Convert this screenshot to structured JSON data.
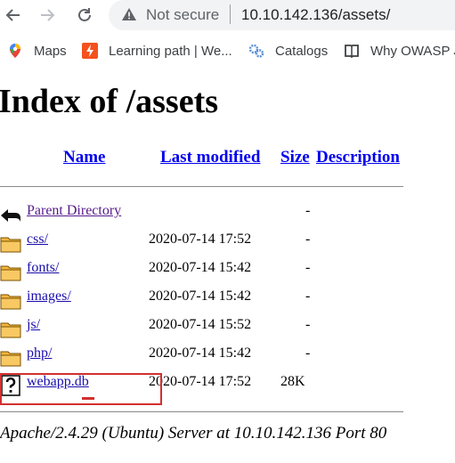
{
  "browser": {
    "security_label": "Not secure",
    "url": "10.10.142.136/assets/",
    "bookmarks": [
      {
        "label": "Maps",
        "icon": "maps-icon"
      },
      {
        "label": "Learning path | We...",
        "icon": "learning-path-icon"
      },
      {
        "label": "Catalogs",
        "icon": "catalogs-icon"
      },
      {
        "label": "Why OWASP Ju",
        "icon": "owasp-icon"
      }
    ]
  },
  "page": {
    "title": "Index of /assets",
    "columns": {
      "name": "Name",
      "last_modified": "Last modified",
      "size": "Size",
      "description": "Description"
    },
    "rows": [
      {
        "name": "Parent Directory",
        "date": "",
        "size": "-",
        "icon": "back-arrow-icon"
      },
      {
        "name": "css/",
        "date": "2020-07-14 17:52",
        "size": "-",
        "icon": "folder-icon"
      },
      {
        "name": "fonts/",
        "date": "2020-07-14 15:42",
        "size": "-",
        "icon": "folder-icon"
      },
      {
        "name": "images/",
        "date": "2020-07-14 15:42",
        "size": "-",
        "icon": "folder-icon"
      },
      {
        "name": "js/",
        "date": "2020-07-14 15:52",
        "size": "-",
        "icon": "folder-icon"
      },
      {
        "name": "php/",
        "date": "2020-07-14 15:42",
        "size": "-",
        "icon": "folder-icon"
      },
      {
        "name": "webapp.db",
        "date": "2020-07-14 17:52",
        "size": "28K",
        "icon": "unknown-file-icon"
      }
    ],
    "footer": "Apache/2.4.29 (Ubuntu) Server at 10.10.142.136 Port 80"
  },
  "colors": {
    "link": "#1a0dab",
    "visited": "#551a8b",
    "header_link": "#0000ee",
    "annotation": "#d32f2f"
  }
}
